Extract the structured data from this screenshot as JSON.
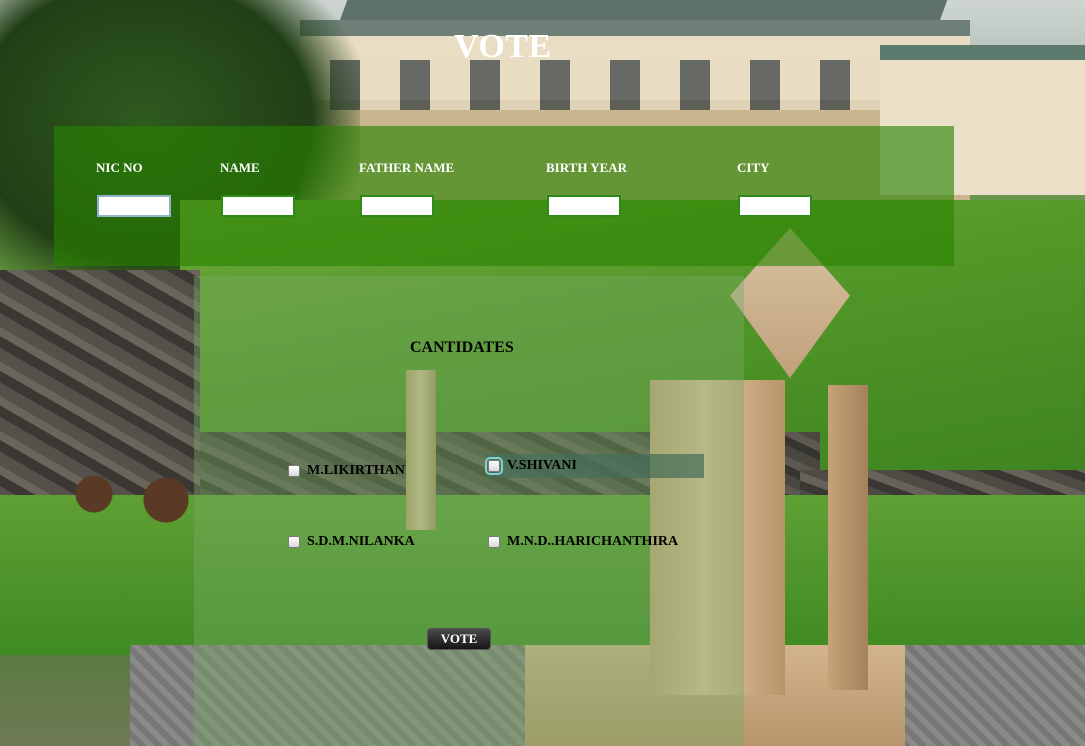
{
  "page": {
    "title": "VOTE"
  },
  "voter_form": {
    "fields": [
      {
        "label": "NIC NO",
        "value": ""
      },
      {
        "label": "NAME",
        "value": ""
      },
      {
        "label": "FATHER NAME",
        "value": ""
      },
      {
        "label": "BIRTH YEAR",
        "value": ""
      },
      {
        "label": "CITY",
        "value": ""
      }
    ]
  },
  "candidates": {
    "heading": "CANTIDATES",
    "list": [
      {
        "name": "M.LIKIRTHAN",
        "checked": false
      },
      {
        "name": "V.SHIVANI",
        "checked": false
      },
      {
        "name": "S.D.M.NILANKA",
        "checked": false
      },
      {
        "name": "M.N.D..HARICHANTHIRA",
        "checked": false
      }
    ]
  },
  "actions": {
    "vote_label": "VOTE"
  },
  "colors": {
    "form_band": "#288200",
    "panel": "#78aa64",
    "button": "#1e1e1e",
    "title": "#ffffff"
  }
}
